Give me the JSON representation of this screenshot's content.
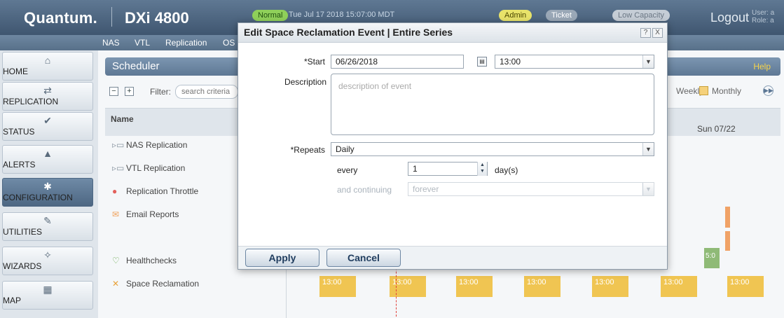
{
  "header": {
    "brand": "Quantum.",
    "model": "DXi 4800",
    "status_normal": "Normal",
    "datetime": "Tue Jul 17 2018 15:07:00 MDT",
    "badge_admin": "Admin",
    "badge_ticket": "Ticket",
    "badge_low_capacity": "Low Capacity",
    "logout": "Logout",
    "user_label": "User: a",
    "role_label": "Role: a"
  },
  "tabs": [
    "NAS",
    "VTL",
    "Replication",
    "OS"
  ],
  "sidebar": {
    "items": [
      {
        "label": "HOME",
        "icon": "home-icon",
        "glyph": "⌂"
      },
      {
        "label": "REPLICATION",
        "icon": "swap-icon",
        "glyph": "⇄"
      },
      {
        "label": "STATUS",
        "icon": "check-circle-icon",
        "glyph": "✔"
      },
      {
        "label": "ALERTS",
        "icon": "bell-icon",
        "glyph": "▲"
      },
      {
        "label": "CONFIGURATION",
        "icon": "gear-icon",
        "glyph": "✱"
      },
      {
        "label": "UTILITIES",
        "icon": "wrench-icon",
        "glyph": "✎"
      },
      {
        "label": "WIZARDS",
        "icon": "wand-icon",
        "glyph": "✧"
      },
      {
        "label": "MAP",
        "icon": "map-icon",
        "glyph": "▦"
      }
    ],
    "active_index": 4
  },
  "scheduler": {
    "title": "Scheduler",
    "help": "Help",
    "filter_label": "Filter:",
    "filter_placeholder": "search criteria",
    "view_weekly": "Weekly",
    "view_monthly": "Monthly",
    "col_name": "Name",
    "day_header": "Sun 07/22",
    "rows": [
      {
        "label": "NAS Replication",
        "icon": "folder-icon"
      },
      {
        "label": "VTL Replication",
        "icon": "folder-icon"
      },
      {
        "label": "Replication Throttle",
        "icon": "throttle-icon"
      },
      {
        "label": "Email Reports",
        "icon": "email-icon"
      },
      {
        "label": "Healthchecks",
        "icon": "stethoscope-icon"
      },
      {
        "label": "Space Reclamation",
        "icon": "broom-icon"
      }
    ],
    "event_time": "13:00",
    "healthcheck_time": "5:0"
  },
  "dialog": {
    "title": "Edit Space Reclamation Event | Entire Series",
    "help_btn": "?",
    "close_btn": "X",
    "start_label": "*Start",
    "start_date": "06/26/2018",
    "start_time": "13:00",
    "description_label": "Description",
    "description_placeholder": "description of event",
    "repeats_label": "*Repeats",
    "repeats_value": "Daily",
    "every_label": "every",
    "every_value": "1",
    "every_unit": "day(s)",
    "continuing_label": "and continuing",
    "continuing_value": "forever",
    "apply": "Apply",
    "cancel": "Cancel"
  }
}
